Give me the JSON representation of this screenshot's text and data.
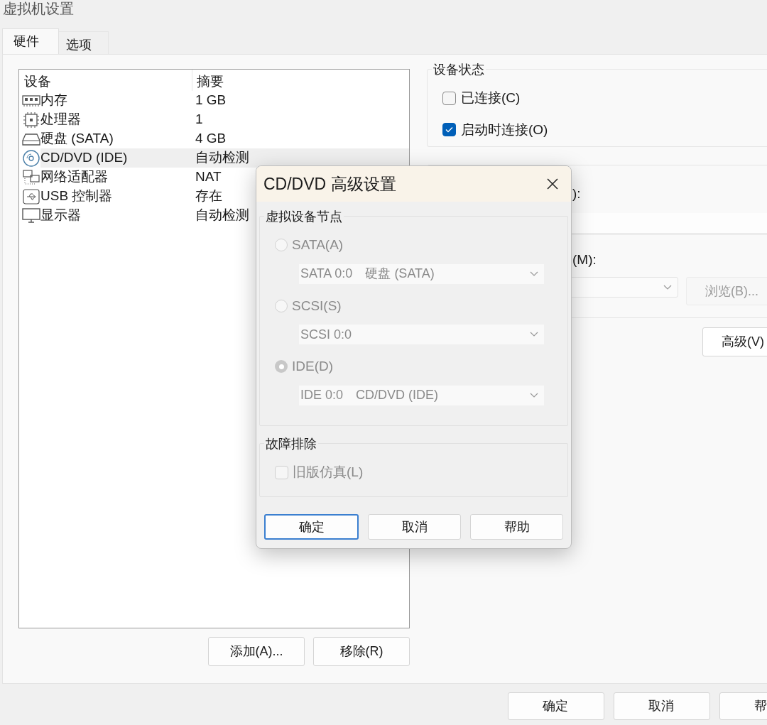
{
  "window": {
    "title": "虚拟机设置"
  },
  "tabs": [
    {
      "label": "硬件",
      "selected": true
    },
    {
      "label": "选项",
      "selected": false
    }
  ],
  "device_table": {
    "columns": [
      "设备",
      "摘要"
    ],
    "rows": [
      {
        "device": "内存",
        "summary": "1 GB",
        "selected": false
      },
      {
        "device": "处理器",
        "summary": "1",
        "selected": false
      },
      {
        "device": "硬盘 (SATA)",
        "summary": "4 GB",
        "selected": false
      },
      {
        "device": "CD/DVD (IDE)",
        "summary": "自动检测",
        "selected": true
      },
      {
        "device": "网络适配器",
        "summary": "NAT",
        "selected": false
      },
      {
        "device": "USB 控制器",
        "summary": "存在",
        "selected": false
      },
      {
        "device": "显示器",
        "summary": "自动检测",
        "selected": false
      }
    ]
  },
  "device_buttons": [
    "添加(A)...",
    "移除(R)"
  ],
  "device_status": {
    "title": "设备状态",
    "options": [
      {
        "label": "已连接(C)",
        "checked": false
      },
      {
        "label": "启动时连接(O)",
        "checked": true
      }
    ]
  },
  "connection": {
    "label_1": "):",
    "label_2": "(M):",
    "browse_button": {
      "label": "浏览(B)...",
      "disabled": true
    }
  },
  "advanced_button": "高级(V)",
  "footer_buttons": [
    "确定",
    "取消",
    "帮"
  ],
  "dialog": {
    "title": "CD/DVD 高级设置",
    "node_group": {
      "title": "虚拟设备节点",
      "disabled": true,
      "options": [
        {
          "label": "SATA(A)",
          "selected": false,
          "node": "SATA 0:0",
          "device": "硬盘 (SATA)"
        },
        {
          "label": "SCSI(S)",
          "selected": false,
          "node": "SCSI 0:0"
        },
        {
          "label": "IDE(D)",
          "selected": true,
          "node": "IDE 0:0",
          "device": "CD/DVD (IDE)"
        }
      ]
    },
    "troubleshoot_group": {
      "title": "故障排除",
      "options": [
        {
          "label": "旧版仿真(L)",
          "checked": false,
          "disabled": true
        }
      ]
    },
    "buttons": [
      {
        "label": "确定",
        "default": true
      },
      {
        "label": "取消",
        "default": false
      },
      {
        "label": "帮助",
        "default": false
      }
    ]
  }
}
